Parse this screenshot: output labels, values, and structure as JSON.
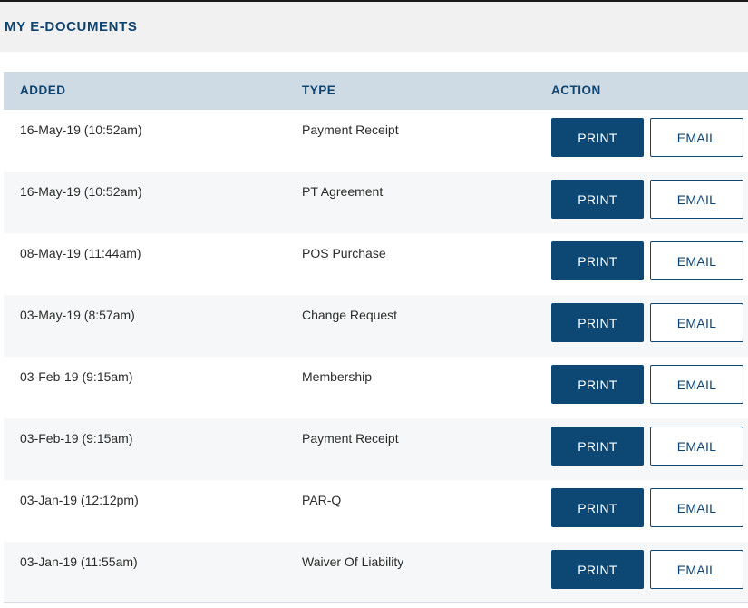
{
  "header": {
    "title": "MY E-DOCUMENTS"
  },
  "table": {
    "columns": {
      "added": "ADDED",
      "type": "TYPE",
      "action": "ACTION"
    },
    "rows": [
      {
        "added": "16-May-19 (10:52am)",
        "type": "Payment Receipt",
        "print_label": "PRINT",
        "email_label": "EMAIL"
      },
      {
        "added": "16-May-19 (10:52am)",
        "type": "PT Agreement",
        "print_label": "PRINT",
        "email_label": "EMAIL"
      },
      {
        "added": "08-May-19 (11:44am)",
        "type": "POS Purchase",
        "print_label": "PRINT",
        "email_label": "EMAIL"
      },
      {
        "added": "03-May-19 (8:57am)",
        "type": "Change Request",
        "print_label": "PRINT",
        "email_label": "EMAIL"
      },
      {
        "added": "03-Feb-19 (9:15am)",
        "type": "Membership",
        "print_label": "PRINT",
        "email_label": "EMAIL"
      },
      {
        "added": "03-Feb-19 (9:15am)",
        "type": "Payment Receipt",
        "print_label": "PRINT",
        "email_label": "EMAIL"
      },
      {
        "added": "03-Jan-19 (12:12pm)",
        "type": "PAR-Q",
        "print_label": "PRINT",
        "email_label": "EMAIL"
      },
      {
        "added": "03-Jan-19 (11:55am)",
        "type": "Waiver Of Liability",
        "print_label": "PRINT",
        "email_label": "EMAIL"
      }
    ]
  },
  "colors": {
    "accent": "#0d4874",
    "header_band": "#cfdbe4",
    "title_band": "#f1f1f1",
    "alt_row": "#f6f7f8"
  }
}
